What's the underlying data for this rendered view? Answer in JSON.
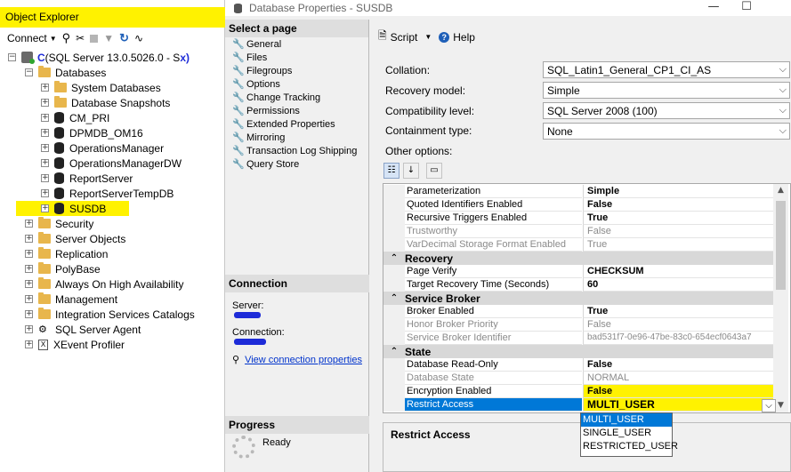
{
  "object_explorer": {
    "title": "Object Explorer",
    "toolbar": {
      "connect_label": "Connect"
    },
    "server_node": {
      "obscured_prefix": "C",
      "text": "(SQL Server 13.0.5026.0 - S",
      "obscured_suffix": "x)"
    },
    "databases_label": "Databases",
    "databases": [
      {
        "name": "System Databases",
        "icon": "folder-icon"
      },
      {
        "name": "Database Snapshots",
        "icon": "folder-icon"
      },
      {
        "name": "CM_PRI",
        "icon": "database-icon"
      },
      {
        "name": "DPMDB_OM16",
        "icon": "database-icon"
      },
      {
        "name": "OperationsManager",
        "icon": "database-icon"
      },
      {
        "name": "OperationsManagerDW",
        "icon": "database-icon"
      },
      {
        "name": "ReportServer",
        "icon": "database-icon"
      },
      {
        "name": "ReportServerTempDB",
        "icon": "database-icon"
      },
      {
        "name": "SUSDB",
        "icon": "database-icon",
        "highlighted": true
      }
    ],
    "top_nodes": [
      "Security",
      "Server Objects",
      "Replication",
      "PolyBase",
      "Always On High Availability",
      "Management",
      "Integration Services Catalogs",
      "SQL Server Agent",
      "XEvent Profiler"
    ],
    "highlight_color": "#fff200"
  },
  "dialog": {
    "title": "Database Properties - SUSDB",
    "select_page_header": "Select a page",
    "pages": [
      "General",
      "Files",
      "Filegroups",
      "Options",
      "Change Tracking",
      "Permissions",
      "Extended Properties",
      "Mirroring",
      "Transaction Log Shipping",
      "Query Store"
    ],
    "connection_header": "Connection",
    "server_label": "Server:",
    "connection_label": "Connection:",
    "view_connection_link": "View connection properties",
    "progress_header": "Progress",
    "progress_status": "Ready",
    "toolbar": {
      "script_label": "Script",
      "help_label": "Help"
    },
    "fields": [
      {
        "label": "Collation:",
        "value": "SQL_Latin1_General_CP1_CI_AS"
      },
      {
        "label": "Recovery model:",
        "value": "Simple"
      },
      {
        "label": "Compatibility level:",
        "value": "SQL Server 2008 (100)"
      },
      {
        "label": "Containment type:",
        "value": "None"
      }
    ],
    "other_options_label": "Other options:",
    "grid": {
      "top_rows": [
        {
          "name": "Parameterization",
          "value": "Simple",
          "bold": true,
          "disabled": false
        },
        {
          "name": "Quoted Identifiers Enabled",
          "value": "False",
          "bold": true,
          "disabled": false
        },
        {
          "name": "Recursive Triggers Enabled",
          "value": "True",
          "bold": true,
          "disabled": false
        },
        {
          "name": "Trustworthy",
          "value": "False",
          "bold": false,
          "disabled": true
        },
        {
          "name": "VarDecimal Storage Format Enabled",
          "value": "True",
          "bold": false,
          "disabled": true
        }
      ],
      "recovery": {
        "category": "Recovery",
        "rows": [
          {
            "name": "Page Verify",
            "value": "CHECKSUM",
            "bold": true,
            "disabled": false
          },
          {
            "name": "Target Recovery Time (Seconds)",
            "value": "60",
            "bold": true,
            "disabled": false
          }
        ]
      },
      "service_broker": {
        "category": "Service Broker",
        "rows": [
          {
            "name": "Broker Enabled",
            "value": "True",
            "bold": true,
            "disabled": false
          },
          {
            "name": "Honor Broker Priority",
            "value": "False",
            "bold": false,
            "disabled": true
          },
          {
            "name": "Service Broker Identifier",
            "value": "bad531f7-0e96-47be-83c0-654ecf0643a7",
            "bold": false,
            "disabled": true
          }
        ]
      },
      "state": {
        "category": "State",
        "rows": [
          {
            "name": "Database Read-Only",
            "value": "False",
            "bold": true,
            "disabled": false
          },
          {
            "name": "Database State",
            "value": "NORMAL",
            "bold": false,
            "disabled": true
          },
          {
            "name": "Encryption Enabled",
            "value": "False",
            "bold": true,
            "disabled": false
          }
        ],
        "selected_row": {
          "name": "Restrict Access",
          "value": "MULTI_USER"
        }
      }
    },
    "description_title": "Restrict Access",
    "restrict_access_options": [
      "MULTI_USER",
      "SINGLE_USER",
      "RESTRICTED_USER"
    ],
    "selected_option": "MULTI_USER",
    "selection_color": "#0078d7"
  }
}
